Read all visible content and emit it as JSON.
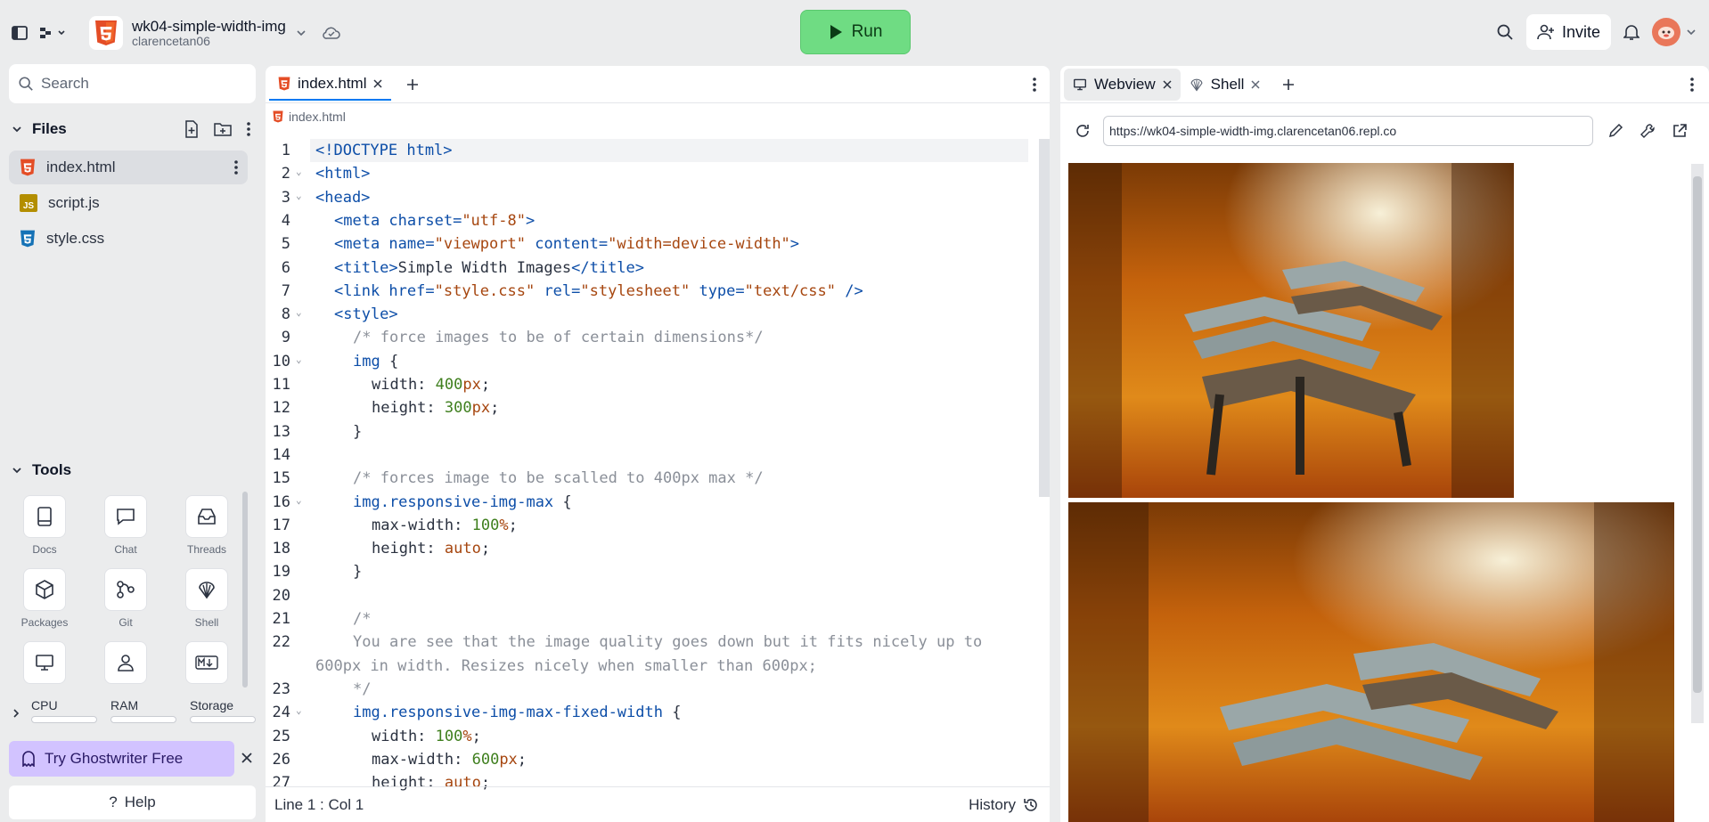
{
  "header": {
    "project_name": "wk04-simple-width-img",
    "project_owner": "clarencetan06",
    "run_label": "Run",
    "invite_label": "Invite"
  },
  "sidebar": {
    "search_placeholder": "Search",
    "files_label": "Files",
    "files": [
      {
        "name": "index.html",
        "icon": "html5-icon"
      },
      {
        "name": "script.js",
        "icon": "js-icon"
      },
      {
        "name": "style.css",
        "icon": "css3-icon"
      }
    ],
    "tools_label": "Tools",
    "tools": [
      {
        "label": "Docs",
        "icon": "docs-icon"
      },
      {
        "label": "Chat",
        "icon": "chat-icon"
      },
      {
        "label": "Threads",
        "icon": "threads-icon"
      },
      {
        "label": "Packages",
        "icon": "package-icon"
      },
      {
        "label": "Git",
        "icon": "git-icon"
      },
      {
        "label": "Shell",
        "icon": "shell-icon"
      },
      {
        "label": "",
        "icon": "monitor-icon"
      },
      {
        "label": "",
        "icon": "user-icon"
      },
      {
        "label": "",
        "icon": "markdown-icon"
      }
    ],
    "resources": [
      {
        "label": "CPU"
      },
      {
        "label": "RAM"
      },
      {
        "label": "Storage"
      }
    ],
    "ghostwriter_label": "Try Ghostwriter Free",
    "help_label": "Help"
  },
  "editor": {
    "tab_label": "index.html",
    "breadcrumb": "index.html",
    "status": "Line 1 : Col 1",
    "history_label": "History",
    "lines": [
      {
        "n": "1",
        "indent": 0,
        "parts": [
          [
            "k-tag",
            "<!DOCTYPE html>"
          ]
        ]
      },
      {
        "n": "2",
        "indent": 0,
        "fold": true,
        "parts": [
          [
            "k-tag",
            "<html>"
          ]
        ]
      },
      {
        "n": "3",
        "indent": 0,
        "fold": true,
        "parts": [
          [
            "k-tag",
            "<head>"
          ]
        ]
      },
      {
        "n": "4",
        "indent": 1,
        "parts": [
          [
            "k-tag",
            "<meta "
          ],
          [
            "k-attr",
            "charset="
          ],
          [
            "k-str",
            "\"utf-8\""
          ],
          [
            "k-tag",
            ">"
          ]
        ]
      },
      {
        "n": "5",
        "indent": 1,
        "parts": [
          [
            "k-tag",
            "<meta "
          ],
          [
            "k-attr",
            "name="
          ],
          [
            "k-str",
            "\"viewport\""
          ],
          [
            "k-attr",
            " content="
          ],
          [
            "k-str",
            "\"width=device-width\""
          ],
          [
            "k-tag",
            ">"
          ]
        ]
      },
      {
        "n": "6",
        "indent": 1,
        "parts": [
          [
            "k-tag",
            "<title>"
          ],
          [
            "k-prop",
            "Simple Width Images"
          ],
          [
            "k-tag",
            "</title>"
          ]
        ]
      },
      {
        "n": "7",
        "indent": 1,
        "parts": [
          [
            "k-tag",
            "<link "
          ],
          [
            "k-attr",
            "href="
          ],
          [
            "k-str",
            "\"style.css\""
          ],
          [
            "k-attr",
            " rel="
          ],
          [
            "k-str",
            "\"stylesheet\""
          ],
          [
            "k-attr",
            " type="
          ],
          [
            "k-str",
            "\"text/css\""
          ],
          [
            "k-tag",
            " />"
          ]
        ]
      },
      {
        "n": "8",
        "indent": 1,
        "fold": true,
        "parts": [
          [
            "k-tag",
            "<style>"
          ]
        ]
      },
      {
        "n": "9",
        "indent": 2,
        "parts": [
          [
            "k-com",
            "/* force images to be of certain dimensions*/"
          ]
        ]
      },
      {
        "n": "10",
        "indent": 2,
        "fold": true,
        "parts": [
          [
            "k-sel",
            "img"
          ],
          [
            "k-prop",
            " {"
          ]
        ]
      },
      {
        "n": "11",
        "indent": 3,
        "parts": [
          [
            "k-prop",
            "width: "
          ],
          [
            "k-num",
            "400"
          ],
          [
            "k-unit",
            "px"
          ],
          [
            "k-prop",
            ";"
          ]
        ]
      },
      {
        "n": "12",
        "indent": 3,
        "parts": [
          [
            "k-prop",
            "height: "
          ],
          [
            "k-num",
            "300"
          ],
          [
            "k-unit",
            "px"
          ],
          [
            "k-prop",
            ";"
          ]
        ]
      },
      {
        "n": "13",
        "indent": 2,
        "parts": [
          [
            "k-prop",
            "}"
          ]
        ]
      },
      {
        "n": "14",
        "indent": 0,
        "parts": []
      },
      {
        "n": "15",
        "indent": 2,
        "parts": [
          [
            "k-com",
            "/* forces image to be scalled to 400px max */"
          ]
        ]
      },
      {
        "n": "16",
        "indent": 2,
        "fold": true,
        "parts": [
          [
            "k-sel",
            "img.responsive-img-max"
          ],
          [
            "k-prop",
            " {"
          ]
        ]
      },
      {
        "n": "17",
        "indent": 3,
        "parts": [
          [
            "k-prop",
            "max-width: "
          ],
          [
            "k-num",
            "100"
          ],
          [
            "k-unit",
            "%"
          ],
          [
            "k-prop",
            ";"
          ]
        ]
      },
      {
        "n": "18",
        "indent": 3,
        "parts": [
          [
            "k-prop",
            "height: "
          ],
          [
            "k-kw",
            "auto"
          ],
          [
            "k-prop",
            ";"
          ]
        ]
      },
      {
        "n": "19",
        "indent": 2,
        "parts": [
          [
            "k-prop",
            "}"
          ]
        ]
      },
      {
        "n": "20",
        "indent": 0,
        "parts": []
      },
      {
        "n": "21",
        "indent": 2,
        "parts": [
          [
            "k-com",
            "/*"
          ]
        ]
      },
      {
        "n": "22",
        "indent": 2,
        "parts": [
          [
            "k-com",
            "You are see that the image quality goes down but it fits nicely up to"
          ]
        ]
      },
      {
        "n": "",
        "indent": 0,
        "parts": [
          [
            "k-com",
            "600px in width. Resizes nicely when smaller than 600px;"
          ]
        ]
      },
      {
        "n": "23",
        "indent": 2,
        "parts": [
          [
            "k-com",
            "*/"
          ]
        ]
      },
      {
        "n": "24",
        "indent": 2,
        "fold": true,
        "parts": [
          [
            "k-sel",
            "img.responsive-img-max-fixed-width"
          ],
          [
            "k-prop",
            " {"
          ]
        ]
      },
      {
        "n": "25",
        "indent": 3,
        "parts": [
          [
            "k-prop",
            "width: "
          ],
          [
            "k-num",
            "100"
          ],
          [
            "k-unit",
            "%"
          ],
          [
            "k-prop",
            ";"
          ]
        ]
      },
      {
        "n": "26",
        "indent": 3,
        "parts": [
          [
            "k-prop",
            "max-width: "
          ],
          [
            "k-num",
            "600"
          ],
          [
            "k-unit",
            "px"
          ],
          [
            "k-prop",
            ";"
          ]
        ]
      },
      {
        "n": "27",
        "indent": 3,
        "parts": [
          [
            "k-prop",
            "height: "
          ],
          [
            "k-kw",
            "auto"
          ],
          [
            "k-prop",
            ";"
          ]
        ]
      }
    ]
  },
  "webview": {
    "tab_webview": "Webview",
    "tab_shell": "Shell",
    "url": "https://wk04-simple-width-img.clarencetan06.repl.co"
  },
  "colors": {
    "run": "#6fdc83",
    "ghostwriter": "#d2c3ff",
    "accent": "#0079f2"
  }
}
